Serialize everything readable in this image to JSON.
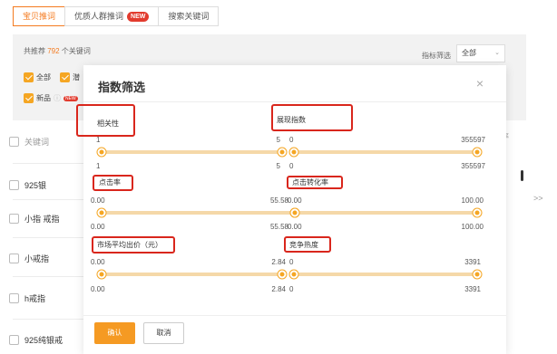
{
  "tabs": [
    {
      "label": "宝贝推词",
      "active": true
    },
    {
      "label": "优质人群推词",
      "badge": "NEW"
    },
    {
      "label": "搜索关键词"
    }
  ],
  "summary": {
    "prefix": "共推荐",
    "count": "792",
    "suffix": "个关键词"
  },
  "filter": {
    "label": "指标筛选",
    "value": "全部"
  },
  "checks": {
    "all": "全部",
    "potential": "潜",
    "new_item": "新品",
    "new_badge": "NEW"
  },
  "table": {
    "header": "关键词",
    "rows": [
      "925银",
      "小指 戒指",
      "小戒指",
      "h戒指",
      "925纯银戒"
    ],
    "right_header": "率"
  },
  "expand_icon": ">>",
  "modal": {
    "title": "指数筛选",
    "close": "×",
    "filters": [
      {
        "label": "相关性",
        "min": "1",
        "max": "5",
        "sel_min": "1",
        "sel_max": "5",
        "from": 0,
        "to": 1
      },
      {
        "label": "展现指数",
        "min": "0",
        "max": "355597",
        "sel_min": "0",
        "sel_max": "355597",
        "from": 0,
        "to": 1
      },
      {
        "label": "点击率",
        "min": "0.00",
        "max": "55.58",
        "sel_min": "0.00",
        "sel_max": "55.58",
        "from": 0,
        "to": 1
      },
      {
        "label": "点击转化率",
        "min": "0.00",
        "max": "100.00",
        "sel_min": "0.00",
        "sel_max": "100.00",
        "from": 0,
        "to": 1
      },
      {
        "label": "市场平均出价（元）",
        "min": "0.00",
        "max": "2.84",
        "sel_min": "0.00",
        "sel_max": "2.84",
        "from": 0,
        "to": 1
      },
      {
        "label": "竞争热度",
        "min": "0",
        "max": "3391",
        "sel_min": "0",
        "sel_max": "3391",
        "from": 0,
        "to": 1
      }
    ],
    "confirm": "确认",
    "cancel": "取消"
  },
  "colors": {
    "accent": "#f59a23",
    "highlight": "#d9261c",
    "track": "#f5d8a8",
    "badge": "#e23b2e"
  }
}
